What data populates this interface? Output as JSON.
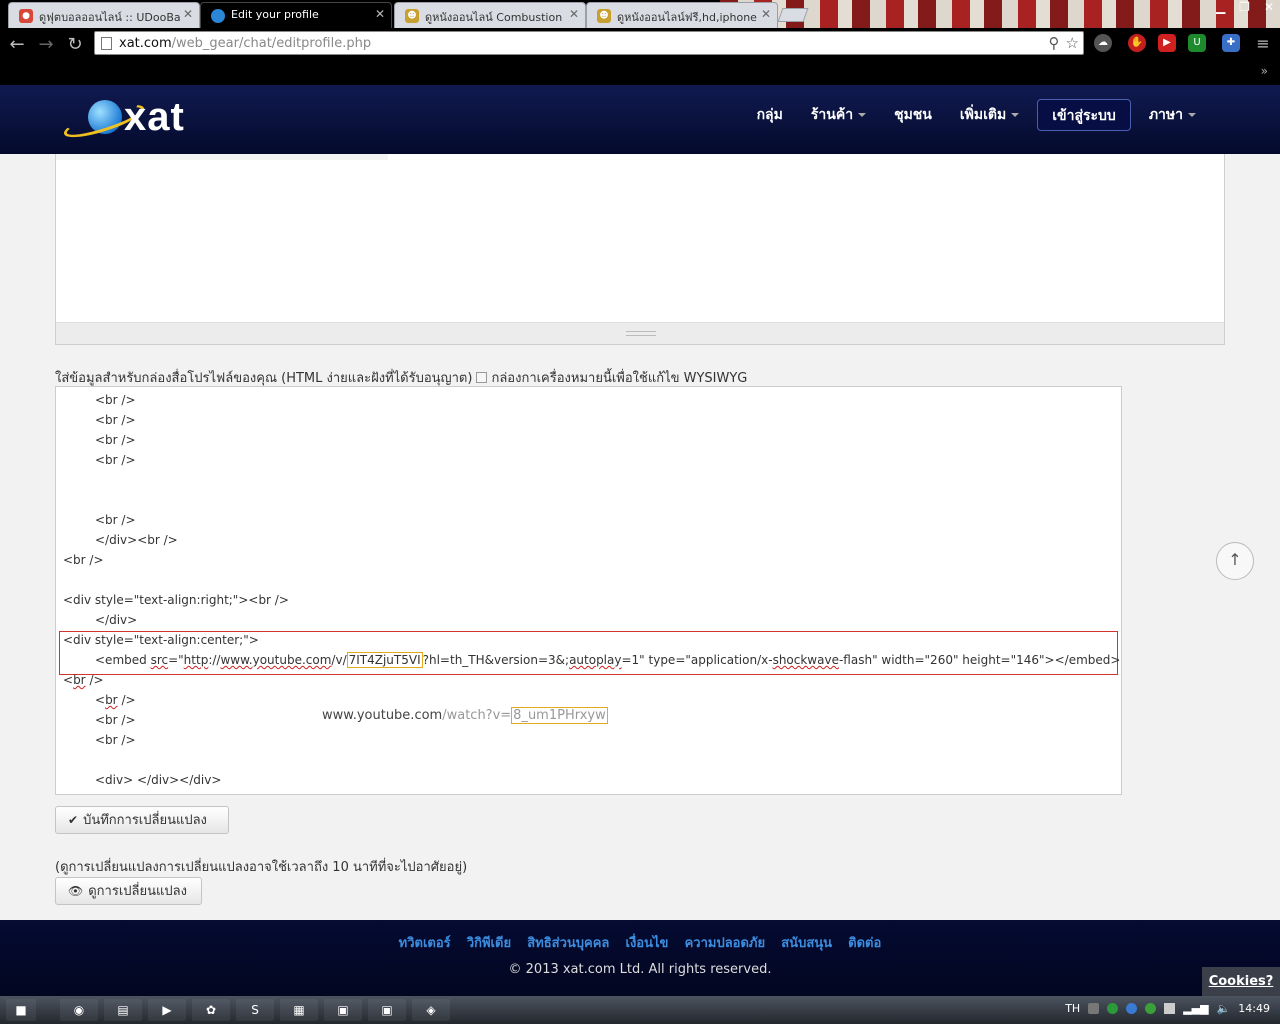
{
  "browser": {
    "tabs": [
      {
        "title": "ดูฟุตบอลออนไลน์ :: UDooBa",
        "active": false,
        "icon_color": "#d9463a"
      },
      {
        "title": "Edit your profile",
        "active": true,
        "icon_color": "#2a86d6"
      },
      {
        "title": "ดูหนังออนไลน์ Combustion",
        "active": false,
        "icon_color": "#c8a030"
      },
      {
        "title": "ดูหนังออนไลน์ฟรี,hd,iphone",
        "active": false,
        "icon_color": "#c8a030"
      }
    ],
    "url_host": "xat.com",
    "url_path": "/web_gear/chat/editprofile.php"
  },
  "site": {
    "logo_text": "xat",
    "nav": [
      {
        "label": "กลุ่ม",
        "caret": false
      },
      {
        "label": "ร้านค้า",
        "caret": true
      },
      {
        "label": "ชุมชน",
        "caret": false
      },
      {
        "label": "เพิ่มเติม",
        "caret": true
      }
    ],
    "login_label": "เข้าสู่ระบบ",
    "language_label": "ภาษา"
  },
  "form": {
    "label": "ใส่ข้อมูลสำหรับกล่องสื่อโปรไฟล์ของคุณ (HTML ง่ายและฝังที่ได้รับอนุญาต)",
    "checkbox_label": "กล่องกาเครื่องหมายนี้เพื่อใช้แก้ไข WYSIWYG",
    "code": {
      "br": "<br />",
      "div_close_br": "</div><br />",
      "div_right": "<div style=\"text-align:right;\"><br />",
      "div_close": "</div>",
      "div_center": "<div style=\"text-align:center;\">",
      "embed_pre": "<embed ",
      "embed_src": "src",
      "embed_mid1": "=\"",
      "embed_http": "http",
      "embed_sep": "://",
      "embed_www": "www.youtube.com",
      "embed_v": "/v/",
      "embed_id": "7IT4ZjuT5VI",
      "embed_q": "?hl=th_TH&version=3&;",
      "embed_autoplay": "autoplay",
      "embed_type_pre": "=1\" type=\"application/x-",
      "embed_shockwave": "shockwave",
      "embed_rest": "-flash\" width=\"260\" height=\"146\"></embed>",
      "br_lt": "<",
      "br_word": "br",
      "br_tail": " />",
      "div_empty": "<div> </div></div>"
    },
    "overlay_url_host": "www.youtube.com",
    "overlay_url_path": "/watch?v=",
    "overlay_url_id": "8_um1PHrxyw",
    "save_label": "บันทึกการเปลี่ยนแปลง",
    "note": "(ดูการเปลี่ยนแปลงการเปลี่ยนแปลงอาจใช้เวลาถึง 10 นาทีที่จะไปอาศัยอยู่)",
    "preview_label": "ดูการเปลี่ยนแปลง"
  },
  "footer": {
    "links": [
      "ทวิตเตอร์",
      "วิกิพีเดีย",
      "สิทธิส่วนบุคคล",
      "เงื่อนไข",
      "ความปลอดภัย",
      "สนับสนุน",
      "ติดต่อ"
    ],
    "copyright": "© 2013 xat.com Ltd. All rights reserved.",
    "cookies_label": "Cookies?"
  },
  "taskbar": {
    "language": "TH",
    "time": "14:49"
  }
}
